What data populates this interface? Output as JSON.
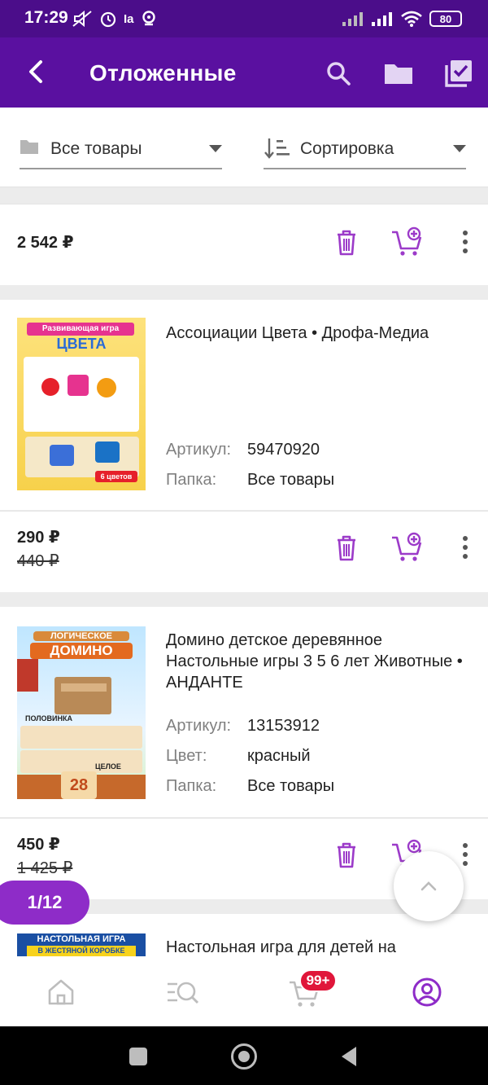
{
  "status_bar": {
    "time": "17:29",
    "carrier_icon": "Ia",
    "battery": "80"
  },
  "app_bar": {
    "title": "Отложенные"
  },
  "filters": {
    "folder": "Все товары",
    "sort": "Сортировка"
  },
  "first_item": {
    "price": "2 542 ₽"
  },
  "items": [
    {
      "title": "Ассоциации Цвета • Дрофа-Медиа",
      "article_label": "Артикул:",
      "article": "59470920",
      "folder_label": "Папка:",
      "folder": "Все товары",
      "price": "290 ₽",
      "old_price": "440 ₽",
      "image_lines": [
        "Развивающая игра",
        "ЦВЕТА",
        "6 цветов"
      ]
    },
    {
      "title": "Домино детское деревянное Настольные игры 3 5 6 лет Животные • АНДАНТЕ",
      "article_label": "Артикул:",
      "article": "13153912",
      "color_label": "Цвет:",
      "color": "красный",
      "folder_label": "Папка:",
      "folder": "Все товары",
      "price": "450 ₽",
      "old_price": "1 425 ₽",
      "image_lines": [
        "ЛОГИЧЕСКОЕ",
        "ДОМИНО",
        "ПОЛОВИНКА",
        "ЦЕЛОЕ",
        "28"
      ]
    },
    {
      "title": "Настольная игра для детей на",
      "image_lines": [
        "НАСТОЛЬНАЯ ИГРА",
        "В ЖЕСТЯНОЙ КОРОБКЕ"
      ]
    }
  ],
  "pager": {
    "label": "1/12"
  },
  "cart_badge": "99+",
  "colors": {
    "primary": "#5a10a0",
    "accent": "#9c3bc9",
    "badge": "#e0163a"
  }
}
